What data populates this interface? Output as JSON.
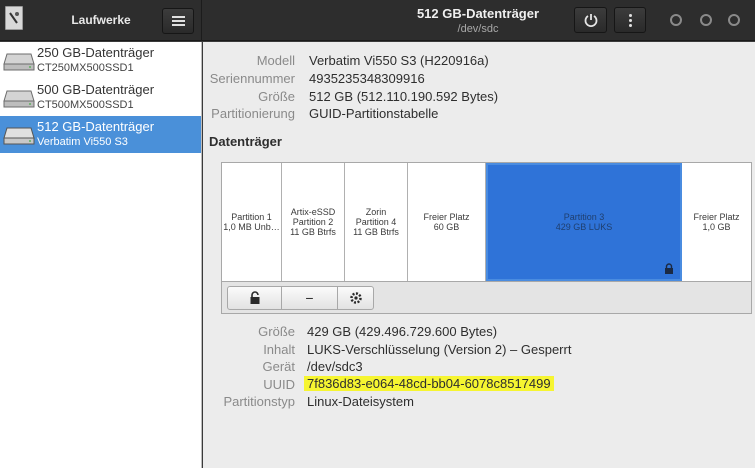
{
  "header": {
    "left_title": "Laufwerke",
    "title": "512 GB-Datenträger",
    "subtitle": "/dev/sdc"
  },
  "sidebar": {
    "drives": [
      {
        "name": "250 GB-Datenträger",
        "model": "CT250MX500SSD1",
        "selected": false
      },
      {
        "name": "500 GB-Datenträger",
        "model": "CT500MX500SSD1",
        "selected": false
      },
      {
        "name": "512 GB-Datenträger",
        "model": "Verbatim Vi550 S3",
        "selected": true
      }
    ]
  },
  "drive_info": {
    "model_label": "Modell",
    "model_value": "Verbatim Vi550 S3 (H220916a)",
    "serial_label": "Seriennummer",
    "serial_value": "4935235348309916",
    "size_label": "Größe",
    "size_value": "512 GB (512.110.190.592 Bytes)",
    "partitioning_label": "Partitionierung",
    "partitioning_value": "GUID-Partitionstabelle"
  },
  "volumes_title": "Datenträger",
  "partitions": [
    {
      "line1": "Partition 1",
      "line2": "1,0 MB Unb…",
      "line3": ""
    },
    {
      "line1": "Artix-eSSD",
      "line2": "Partition 2",
      "line3": "11 GB Btrfs"
    },
    {
      "line1": "Zorin",
      "line2": "Partition 4",
      "line3": "11 GB Btrfs"
    },
    {
      "line1": "Freier Platz",
      "line2": "60 GB",
      "line3": ""
    },
    {
      "line1": "Partition 3",
      "line2": "429 GB LUKS",
      "line3": ""
    },
    {
      "line1": "Freier Platz",
      "line2": "1,0 GB",
      "line3": ""
    }
  ],
  "toolbar": {
    "lock_icon": "lock-open-icon",
    "minus_label": "−",
    "gear_icon": "gear-icon"
  },
  "partition_info": {
    "size_label": "Größe",
    "size_value": "429 GB (429.496.729.600 Bytes)",
    "content_label": "Inhalt",
    "content_value": "LUKS-Verschlüsselung (Version 2) – Gesperrt",
    "device_label": "Gerät",
    "device_value": "/dev/sdc3",
    "uuid_label": "UUID",
    "uuid_value": "7f836d83-e064-48cd-bb04-6078c8517499",
    "type_label": "Partitionstyp",
    "type_value": "Linux-Dateisystem"
  },
  "colors": {
    "selection": "#4a90d9",
    "partition_selected": "#2f73d8",
    "uuid_highlight": "#f6f531"
  }
}
